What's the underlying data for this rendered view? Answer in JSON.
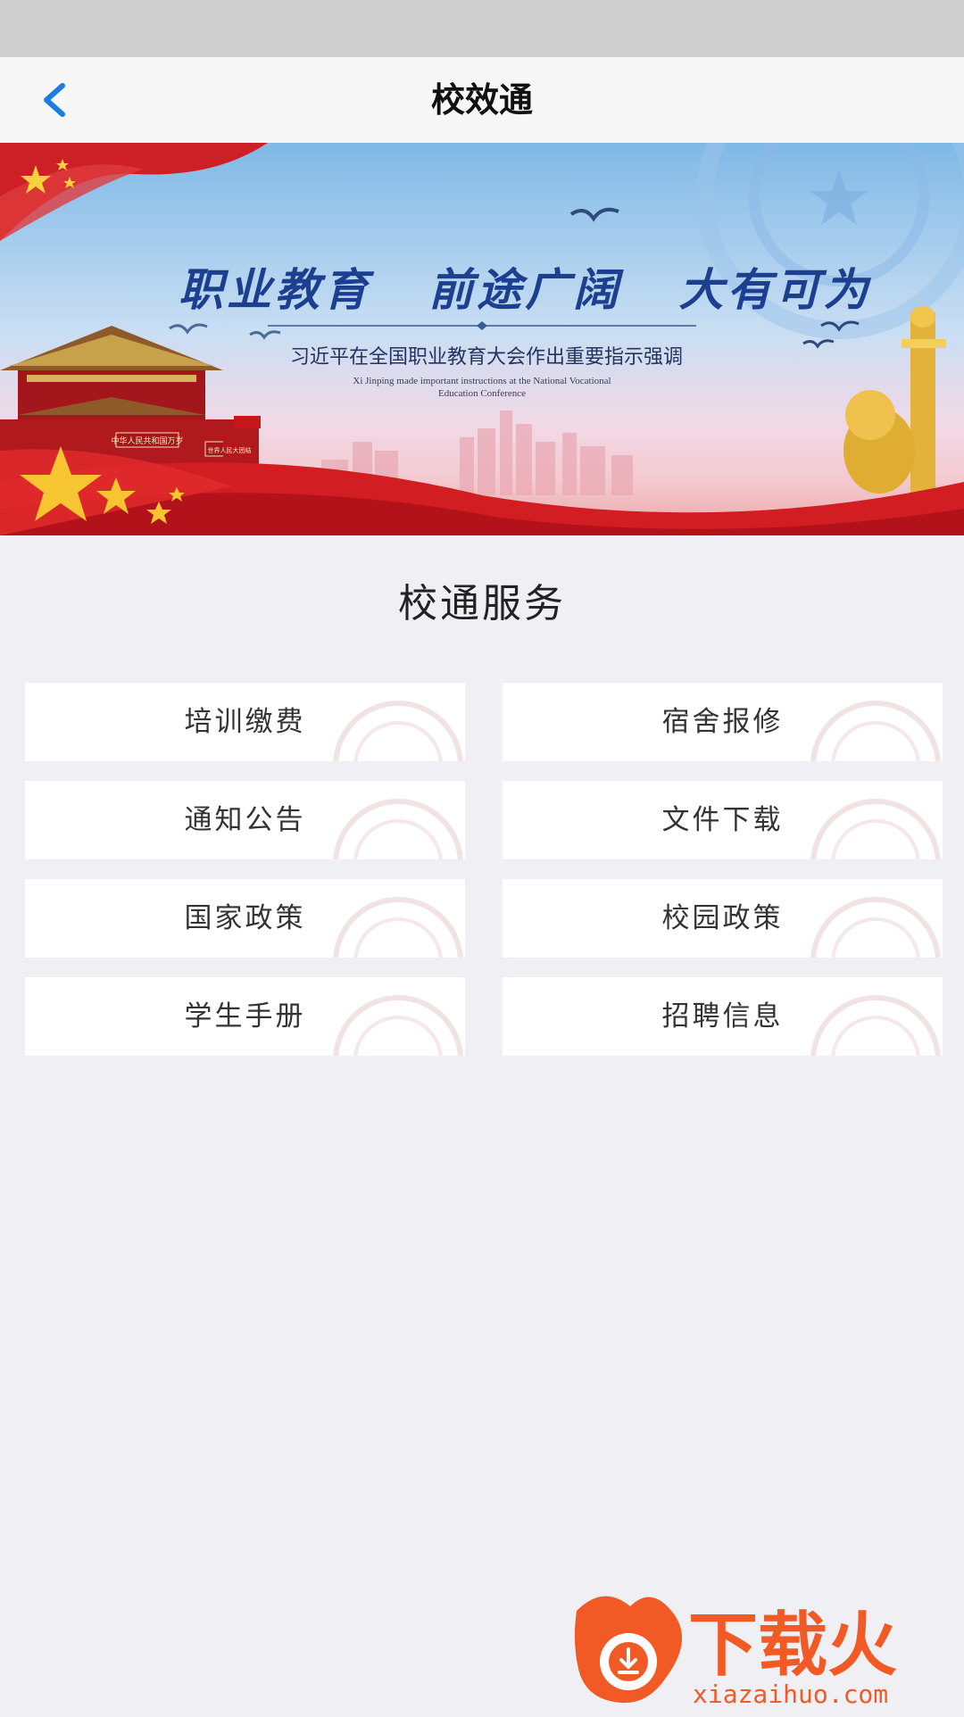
{
  "nav": {
    "title": "校效通"
  },
  "banner": {
    "headline": "职业教育   前途广阔   大有可为",
    "subtitle": "习近平在全国职业教育大会作出重要指示强调",
    "caption_line1": "Xi Jinping made important instructions at the National Vocational",
    "caption_line2": "Education Conference",
    "gate_sign_left": "中华人民共和国万岁",
    "gate_sign_right": "世界人民大团结"
  },
  "section": {
    "title": "校通服务"
  },
  "services": [
    {
      "label": "培训缴费"
    },
    {
      "label": "宿舍报修"
    },
    {
      "label": "通知公告"
    },
    {
      "label": "文件下载"
    },
    {
      "label": "国家政策"
    },
    {
      "label": "校园政策"
    },
    {
      "label": "学生手册"
    },
    {
      "label": "招聘信息"
    }
  ],
  "watermark": {
    "brand_text": "下载火",
    "url_text": "xiazaihuo.com"
  },
  "colors": {
    "accent_blue": "#1a7ee0",
    "banner_red": "#c8161d",
    "logo_orange": "#f15a24"
  }
}
